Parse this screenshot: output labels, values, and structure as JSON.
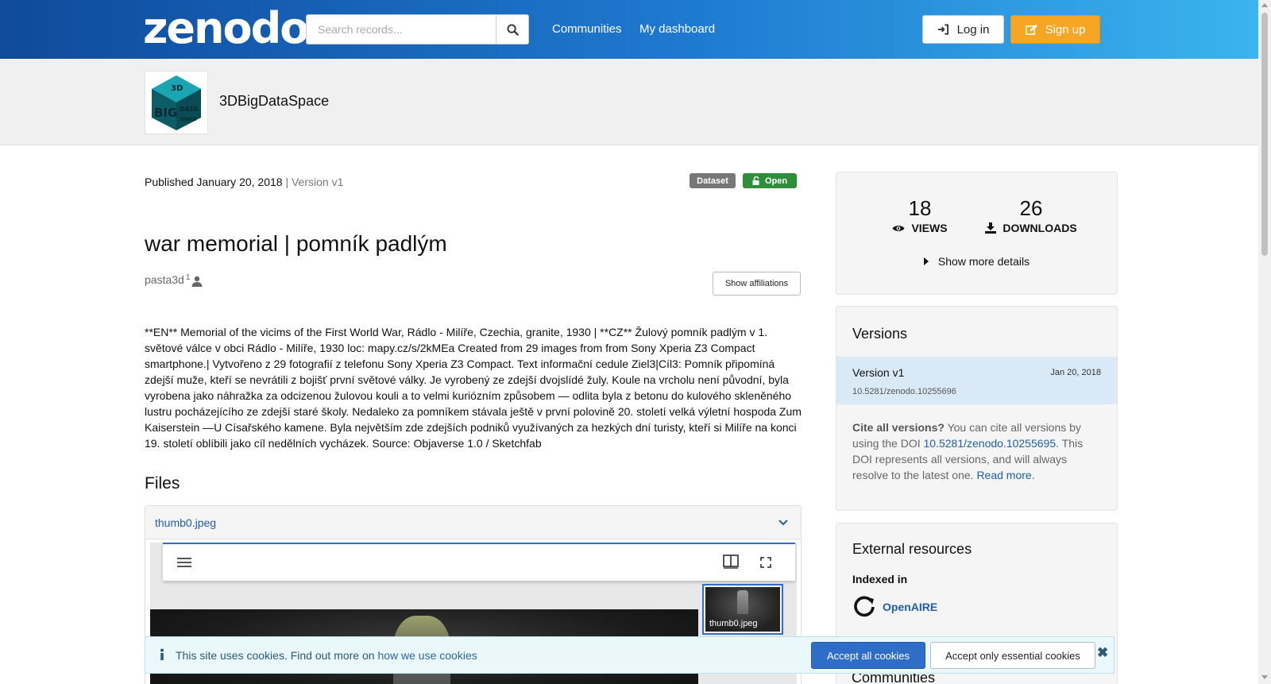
{
  "header": {
    "logo_text": "zenodo",
    "search": {
      "placeholder": "Search records..."
    },
    "nav": {
      "communities": "Communities",
      "dashboard": "My dashboard"
    },
    "login_label": "Log in",
    "signup_label": "Sign up",
    "signup_color": "#f6a623"
  },
  "community": {
    "name": "3DBigDataSpace",
    "logo_letters": {
      "main": "BIG",
      "top": "3D",
      "side": "DATA",
      "bottom": "SPACE"
    }
  },
  "record": {
    "published_label": "Published January 20, 2018",
    "version_label": "| Version v1",
    "badges": {
      "type": "Dataset",
      "access": "Open"
    },
    "title": "war memorial | pomník padlým",
    "creator": {
      "name": "pasta3d",
      "affiliation_ref": "1"
    },
    "show_affiliations": "Show affiliations",
    "description": "**EN** Memorial of the vicims of the First World War, Rádlo - Milíře, Czechia, granite, 1930 | **CZ** Žulový pomník padlým v 1. světové válce v obci Rádlo - Milíře, 1930 loc: mapy.cz/s/2kMEa Created from 29 images from from Sony Xperia Z3 Compact smartphone.| Vytvořeno z 29 fotografií z telefonu Sony Xperia Z3 Compact. Text informační cedule Ziel3|Cíl3: Pomník připomíná zdejší muže, kteří se nevrátili z bojišť první světové války. Je vyrobený ze zdejší dvojslídé žuly. Koule na vrcholu není původní, byla vyrobena jako náhražka za odcizenou žulovou kouli a to velmi kuriózním způsobem — odlita byla z betonu do kulového skleněného lustru pocházejícího ze zdejší staré školy. Nedaleko za pomníkem stávala ještě v první polovině 20. století velká výletní hospoda Zum Kaiserstein —U Císařského kamene. Byla největším zde zdejších podniků využívaných za hezkých dní turisty, kteří si Milíře na konci 19. století oblíbili jako cíl nedělních vycházek. Source: Objaverse 1.0 / Sketchfab",
    "files_heading": "Files",
    "file_name": "thumb0.jpeg",
    "thumb_label": "thumb0.jpeg"
  },
  "stats": {
    "views": "18",
    "views_label": "VIEWS",
    "downloads": "26",
    "downloads_label": "DOWNLOADS",
    "more_details": "Show more details"
  },
  "versions": {
    "heading": "Versions",
    "items": [
      {
        "name": "Version v1",
        "date": "Jan 20, 2018",
        "doi": "10.5281/zenodo.10255696"
      }
    ],
    "cite_bold": "Cite all versions?",
    "cite_text_1": " You can cite all versions by using the DOI ",
    "cite_doi": "10.5281/zenodo.10255695",
    "cite_text_2": ". This DOI represents all versions, and will always resolve to the latest one. ",
    "read_more": "Read more."
  },
  "external": {
    "heading": "External resources",
    "indexed_in": "Indexed in",
    "openaire": "OpenAIRE",
    "communities_heading": "Communities"
  },
  "cookies": {
    "text": "This site uses cookies. Find out more on ",
    "link": "how we use cookies",
    "accept_all": "Accept all cookies",
    "accept_essential": "Accept only essential cookies"
  }
}
